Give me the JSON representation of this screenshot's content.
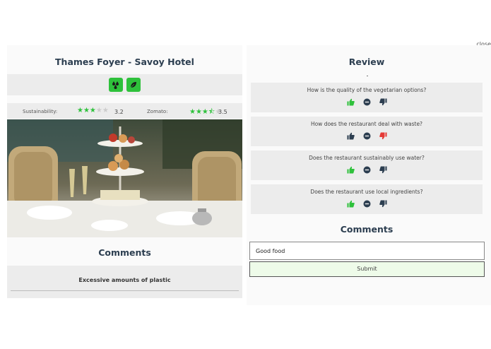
{
  "close_label": "close",
  "restaurant": {
    "name": "Thames Foyer - Savoy Hotel",
    "sustainability_label": "Sustainability:",
    "sustainability_score": "3.2",
    "sustainability_stars": 3,
    "zomato_label": "Zomato:",
    "zomato_score": "3.5",
    "zomato_stars": 3.5,
    "badges": [
      "water-drops-icon",
      "leaf-icon"
    ],
    "accent_color": "#2ec13b"
  },
  "left_comments": {
    "heading": "Comments",
    "items": [
      "Excessive amounts of plastic"
    ]
  },
  "review": {
    "heading": "Review",
    "questions": [
      {
        "text": "How is the quality of the vegetarian options?",
        "selected": "up"
      },
      {
        "text": "How does the restaurant deal with waste?",
        "selected": "down"
      },
      {
        "text": "Does the restaurant sustainably use water?",
        "selected": "up"
      },
      {
        "text": "Does the restaurant use local ingredients?",
        "selected": "up"
      }
    ],
    "comments_heading": "Comments",
    "comment_value": "Good food",
    "submit_label": "Submit"
  },
  "colors": {
    "thumb_up_selected": "#2ec13b",
    "thumb_down_selected": "#e53935",
    "neutral": "#2c3e50"
  }
}
